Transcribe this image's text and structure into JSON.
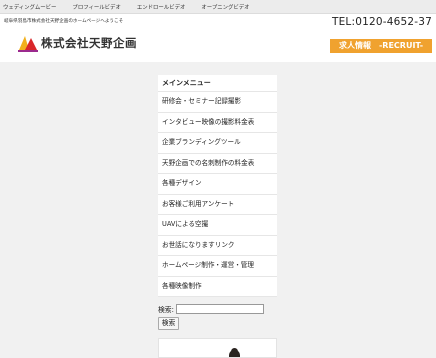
{
  "topnav": {
    "items": [
      "ウェディングムービー",
      "プロフィールビデオ",
      "エンドロールビデオ",
      "オープニングビデオ"
    ]
  },
  "header": {
    "welcome": "岐阜県羽島市株式会社天野企画のホームページへようこそ",
    "tel": "TEL:0120-4652-37",
    "logo_text": "株式会社天野企画",
    "recruit_label": "求人情報　-RECRUIT-"
  },
  "menu": {
    "title": "メインメニュー",
    "items": [
      "研修会・セミナー記録撮影",
      "インタビュー映像の撮影料金表",
      "企業ブランディングツール",
      "天野企画での名刺制作の料金表",
      "各種デザイン",
      "お客様ご利用アンケート",
      "UAVによる空撮",
      "お世話になりますリンク",
      "ホームページ制作・運営・管理",
      "各種映像制作"
    ]
  },
  "search": {
    "label": "検索:",
    "button": "検索"
  },
  "colors": {
    "recruit_bg": "#f0a22f",
    "logo_red": "#d9262a",
    "logo_yellow": "#f2b01c"
  }
}
